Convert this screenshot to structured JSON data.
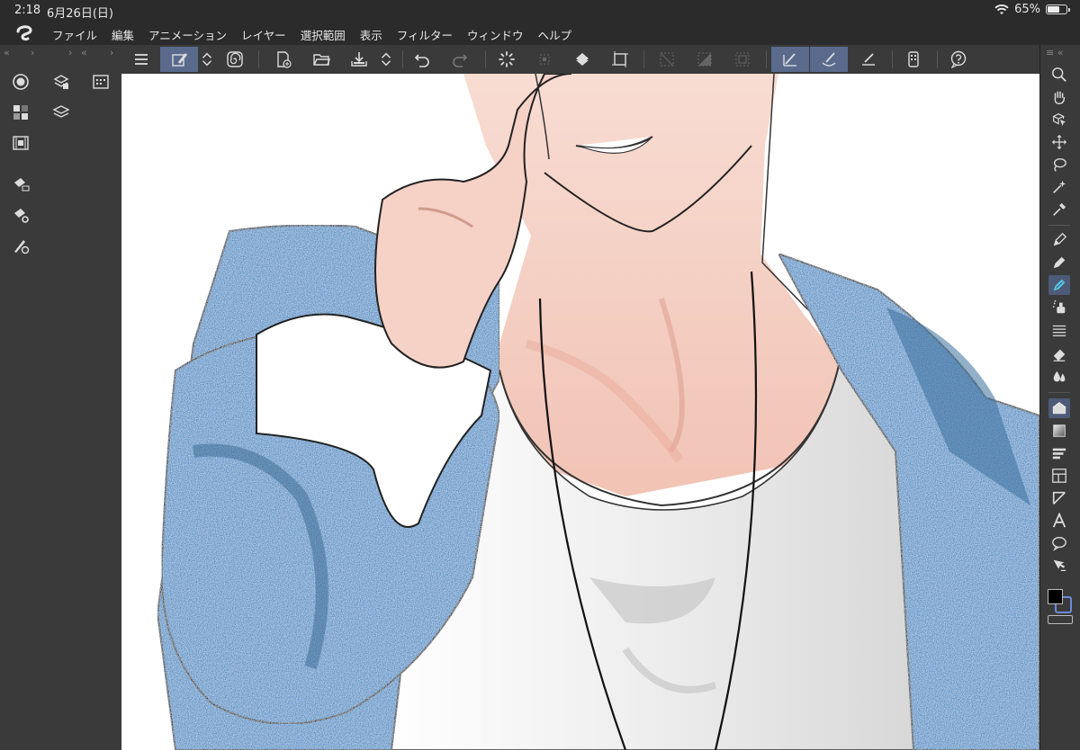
{
  "status": {
    "time": "2:18",
    "date": "6月26日(日)",
    "battery": "65%",
    "battery_level": 0.65
  },
  "menu": {
    "items": [
      "ファイル",
      "編集",
      "アニメーション",
      "レイヤー",
      "選択範囲",
      "表示",
      "フィルター",
      "ウィンドウ",
      "ヘルプ"
    ]
  },
  "toolbar": {
    "buttons": [
      "menu-icon",
      "draw-mode-icon",
      "up-down-icon",
      "spiral-icon",
      "new-canvas-icon",
      "open-folder-icon",
      "save-icon",
      "up-down-icon",
      "undo-icon",
      "redo-icon",
      "loading-icon",
      "transform-icon",
      "fill-icon",
      "crop-icon",
      "select-none-icon",
      "invert-selection-icon",
      "select-all-icon",
      "pen-correction-icon",
      "stabilize-brush-icon",
      "ruler-pen-icon",
      "device-icon",
      "help-icon"
    ],
    "active": [
      "draw-mode-icon",
      "pen-correction-icon",
      "stabilize-brush-icon"
    ]
  },
  "left_panel": {
    "icons": [
      "navigator-icon",
      "sub-view-icon",
      "layer-property-icon",
      "color-palette-icon",
      "layer-icon",
      "timeline-icon",
      "brush-material-icon",
      "tool-settings-icon",
      "brush-size-icon"
    ]
  },
  "right_panel": {
    "tools": [
      "zoom-icon",
      "hand-icon",
      "object-icon",
      "move-icon",
      "lasso-icon",
      "magic-wand-icon",
      "eyedropper-icon",
      "pen-icon",
      "pencil-icon",
      "brush-icon",
      "airbrush-icon",
      "decoration-icon",
      "eraser-icon",
      "blend-icon",
      "fill-icon",
      "gradient-icon",
      "contour-icon",
      "frame-icon",
      "ruler-icon",
      "text-icon",
      "balloon-icon",
      "correct-line-icon"
    ],
    "active_tools": [
      "brush-icon",
      "fill-icon"
    ],
    "colors": {
      "foreground": "#000000",
      "background": "#3a3a3a",
      "accent": "#6a8bd8"
    }
  },
  "canvas": {
    "background": "#ffffff",
    "jacket_color": "#4e8ec4",
    "skin_color": "#f6d3c8",
    "shirt_color": "#f2f2f2"
  }
}
